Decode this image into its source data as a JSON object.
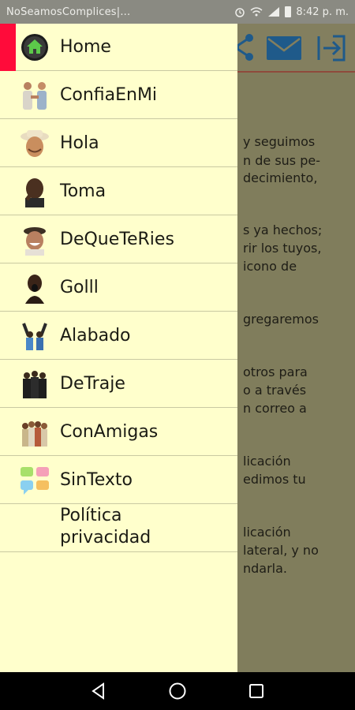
{
  "status_bar": {
    "app_title": "NoSeamosComplices|...",
    "time": "8:42 p. m.",
    "icons": [
      "alarm-icon",
      "wifi-icon",
      "signal-icon",
      "battery-icon"
    ]
  },
  "background_screen": {
    "toolbar_icons": [
      "share-icon",
      "mail-icon",
      "exit-icon"
    ],
    "text_lines": [
      "y seguimos",
      "n de sus pe-",
      "decimiento,",
      "s ya hechos;",
      "rir los tuyos,",
      "icono de",
      "gregaremos",
      "otros para",
      "o a través",
      "n correo a",
      "licación",
      "edimos tu",
      "licación",
      "lateral, y no",
      "ndarla."
    ]
  },
  "drawer": {
    "items": [
      {
        "label": "Home",
        "icon": "home-icon",
        "selected": true
      },
      {
        "label": "ConfiaEnMi",
        "icon": "handshake-icon"
      },
      {
        "label": "Hola",
        "icon": "cowboy-face-icon"
      },
      {
        "label": "Toma",
        "icon": "man-face-icon"
      },
      {
        "label": "DeQueTeRies",
        "icon": "laughing-man-icon"
      },
      {
        "label": "Golll",
        "icon": "goal-man-icon"
      },
      {
        "label": "Alabado",
        "icon": "hands-up-icon"
      },
      {
        "label": "DeTraje",
        "icon": "men-in-suits-icon"
      },
      {
        "label": "ConAmigas",
        "icon": "group-friends-icon"
      },
      {
        "label": "SinTexto",
        "icon": "speech-bubbles-icon"
      },
      {
        "label_line1": "Política",
        "label_line2": "privacidad",
        "icon": "none"
      }
    ]
  },
  "colors": {
    "drawer_bg": "#ffffcc",
    "selected_indicator": "#ff0b3a",
    "toolbar_icon": "#1f5a8a"
  },
  "nav_bar": {
    "buttons": [
      "back-icon",
      "home-circle-icon",
      "recents-icon"
    ]
  }
}
